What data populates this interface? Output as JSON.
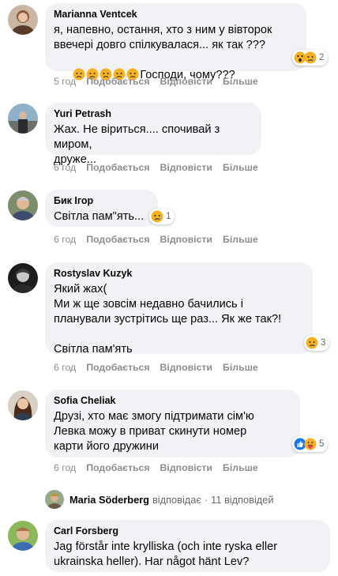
{
  "comments": [
    {
      "author": "Marianna Ventcek",
      "text": "я, напевно, остання, хто з ним у вівторок\nввечері довго спілкувалася... як так ???",
      "text2": "Господи, чому???",
      "time": "5 год",
      "like": "Подобається",
      "reply": "Відповісти",
      "more": "Більше",
      "reaction_count": "2"
    },
    {
      "author": "Yuri Petrash",
      "text": "Жах. Не віриться.... спочивай з миром,\nдруже...",
      "time": "6 год",
      "like": "Подобається",
      "reply": "Відповісти",
      "more": "Більше"
    },
    {
      "author": "Бик Ігор",
      "text": "Світла пам\"ять...",
      "time": "6 год",
      "like": "Подобається",
      "reply": "Відповісти",
      "more": "Більше",
      "reaction_count": "1"
    },
    {
      "author": "Rostyslav Kuzyk",
      "text": "Який жах(\nМи ж ще зовсім недавно бачились і\nпланували зустрітись ще раз... Як же так?!\n\nСвітла пам'ять",
      "time": "6 год",
      "like": "Подобається",
      "reply": "Відповісти",
      "more": "Більше",
      "reaction_count": "3"
    },
    {
      "author": "Sofia Cheliak",
      "text": "Друзі, хто має змогу підтримати сім'ю\nЛевка можу в приват скинути номер\nкарти його дружини",
      "time": "6 год",
      "like": "Подобається",
      "reply": "Відповісти",
      "more": "Більше",
      "reaction_count": "5"
    },
    {
      "author": "Carl Forsberg",
      "text": "Jag förstår inte krylliska (och inte ryska eller\nukrainska heller). Har något hänt Lev?"
    }
  ],
  "reply_summary": {
    "name": "Maria Söderberg",
    "verb": "відповідає",
    "dot": "·",
    "count": "11 відповідей"
  },
  "icons": {
    "sad": "sad-reaction-icon",
    "wow": "wow-reaction-icon",
    "like": "like-reaction-icon",
    "care": "care-reaction-icon"
  }
}
